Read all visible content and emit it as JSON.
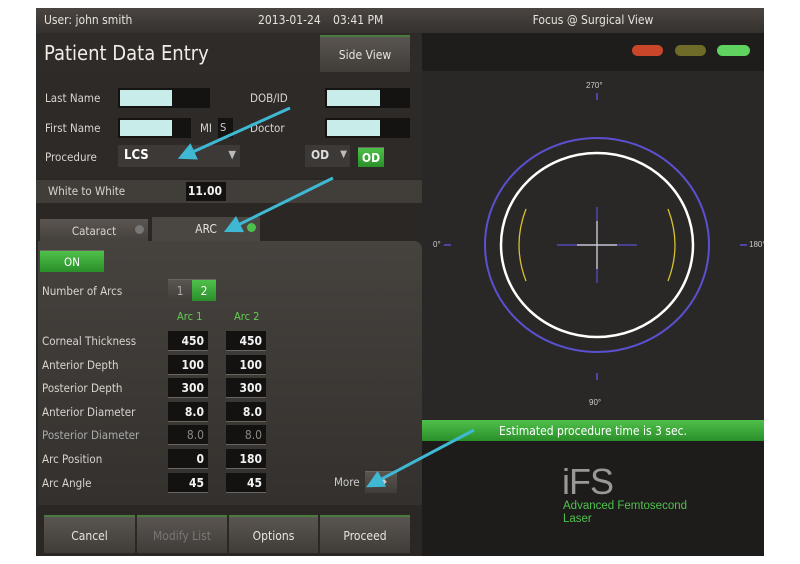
{
  "header": {
    "user": "User: john smith",
    "date": "2013-01-24",
    "time": "03:41 PM",
    "right_title": "Focus @ Surgical View"
  },
  "title": "Patient Data Entry",
  "side_view_button": "Side View",
  "status_lights": [
    "#c8472a",
    "#7a7a2a",
    "#5fd35f"
  ],
  "form": {
    "last_name_label": "Last Name",
    "first_name_label": "First Name",
    "mi_label": "MI",
    "mi_value": "S",
    "dob_label": "DOB/ID",
    "doctor_label": "Doctor",
    "procedure_label": "Procedure",
    "procedure_value": "LCS",
    "eye_select": "OD",
    "eye_button": "OD",
    "wtw_label": "White to White",
    "wtw_value": "11.00"
  },
  "tabs": [
    {
      "label": "Cataract",
      "active": false
    },
    {
      "label": "ARC",
      "active": true
    }
  ],
  "arc": {
    "on_label": "ON",
    "num_arcs_label": "Number of Arcs",
    "num_arcs_options": [
      "1",
      "2"
    ],
    "num_arcs_selected": "2",
    "col_headers": [
      "Arc 1",
      "Arc 2"
    ],
    "rows": [
      {
        "label": "Corneal Thickness",
        "v1": "450",
        "v2": "450"
      },
      {
        "label": "Anterior Depth",
        "v1": "100",
        "v2": "100"
      },
      {
        "label": "Posterior Depth",
        "v1": "300",
        "v2": "300"
      },
      {
        "label": "Anterior Diameter",
        "v1": "8.0",
        "v2": "8.0"
      },
      {
        "label": "Posterior Diameter",
        "v1": "8.0",
        "v2": "8.0",
        "disabled": true
      },
      {
        "label": "Arc Position",
        "v1": "0",
        "v2": "180"
      },
      {
        "label": "Arc Angle",
        "v1": "45",
        "v2": "45"
      }
    ],
    "more_label": "More"
  },
  "footer": {
    "cancel": "Cancel",
    "modify": "Modify List",
    "options": "Options",
    "proceed": "Proceed"
  },
  "view": {
    "top": "270°",
    "bottom": "90°",
    "left": "0°",
    "right": "180°"
  },
  "status_bar": "Estimated procedure time is 3 sec.",
  "logo": {
    "name": "iFS",
    "line1": "Advanced Femtosecond",
    "line2": "Laser"
  },
  "colors": {
    "accent_green": "#3cb043",
    "arrow": "#3fb8d4"
  }
}
